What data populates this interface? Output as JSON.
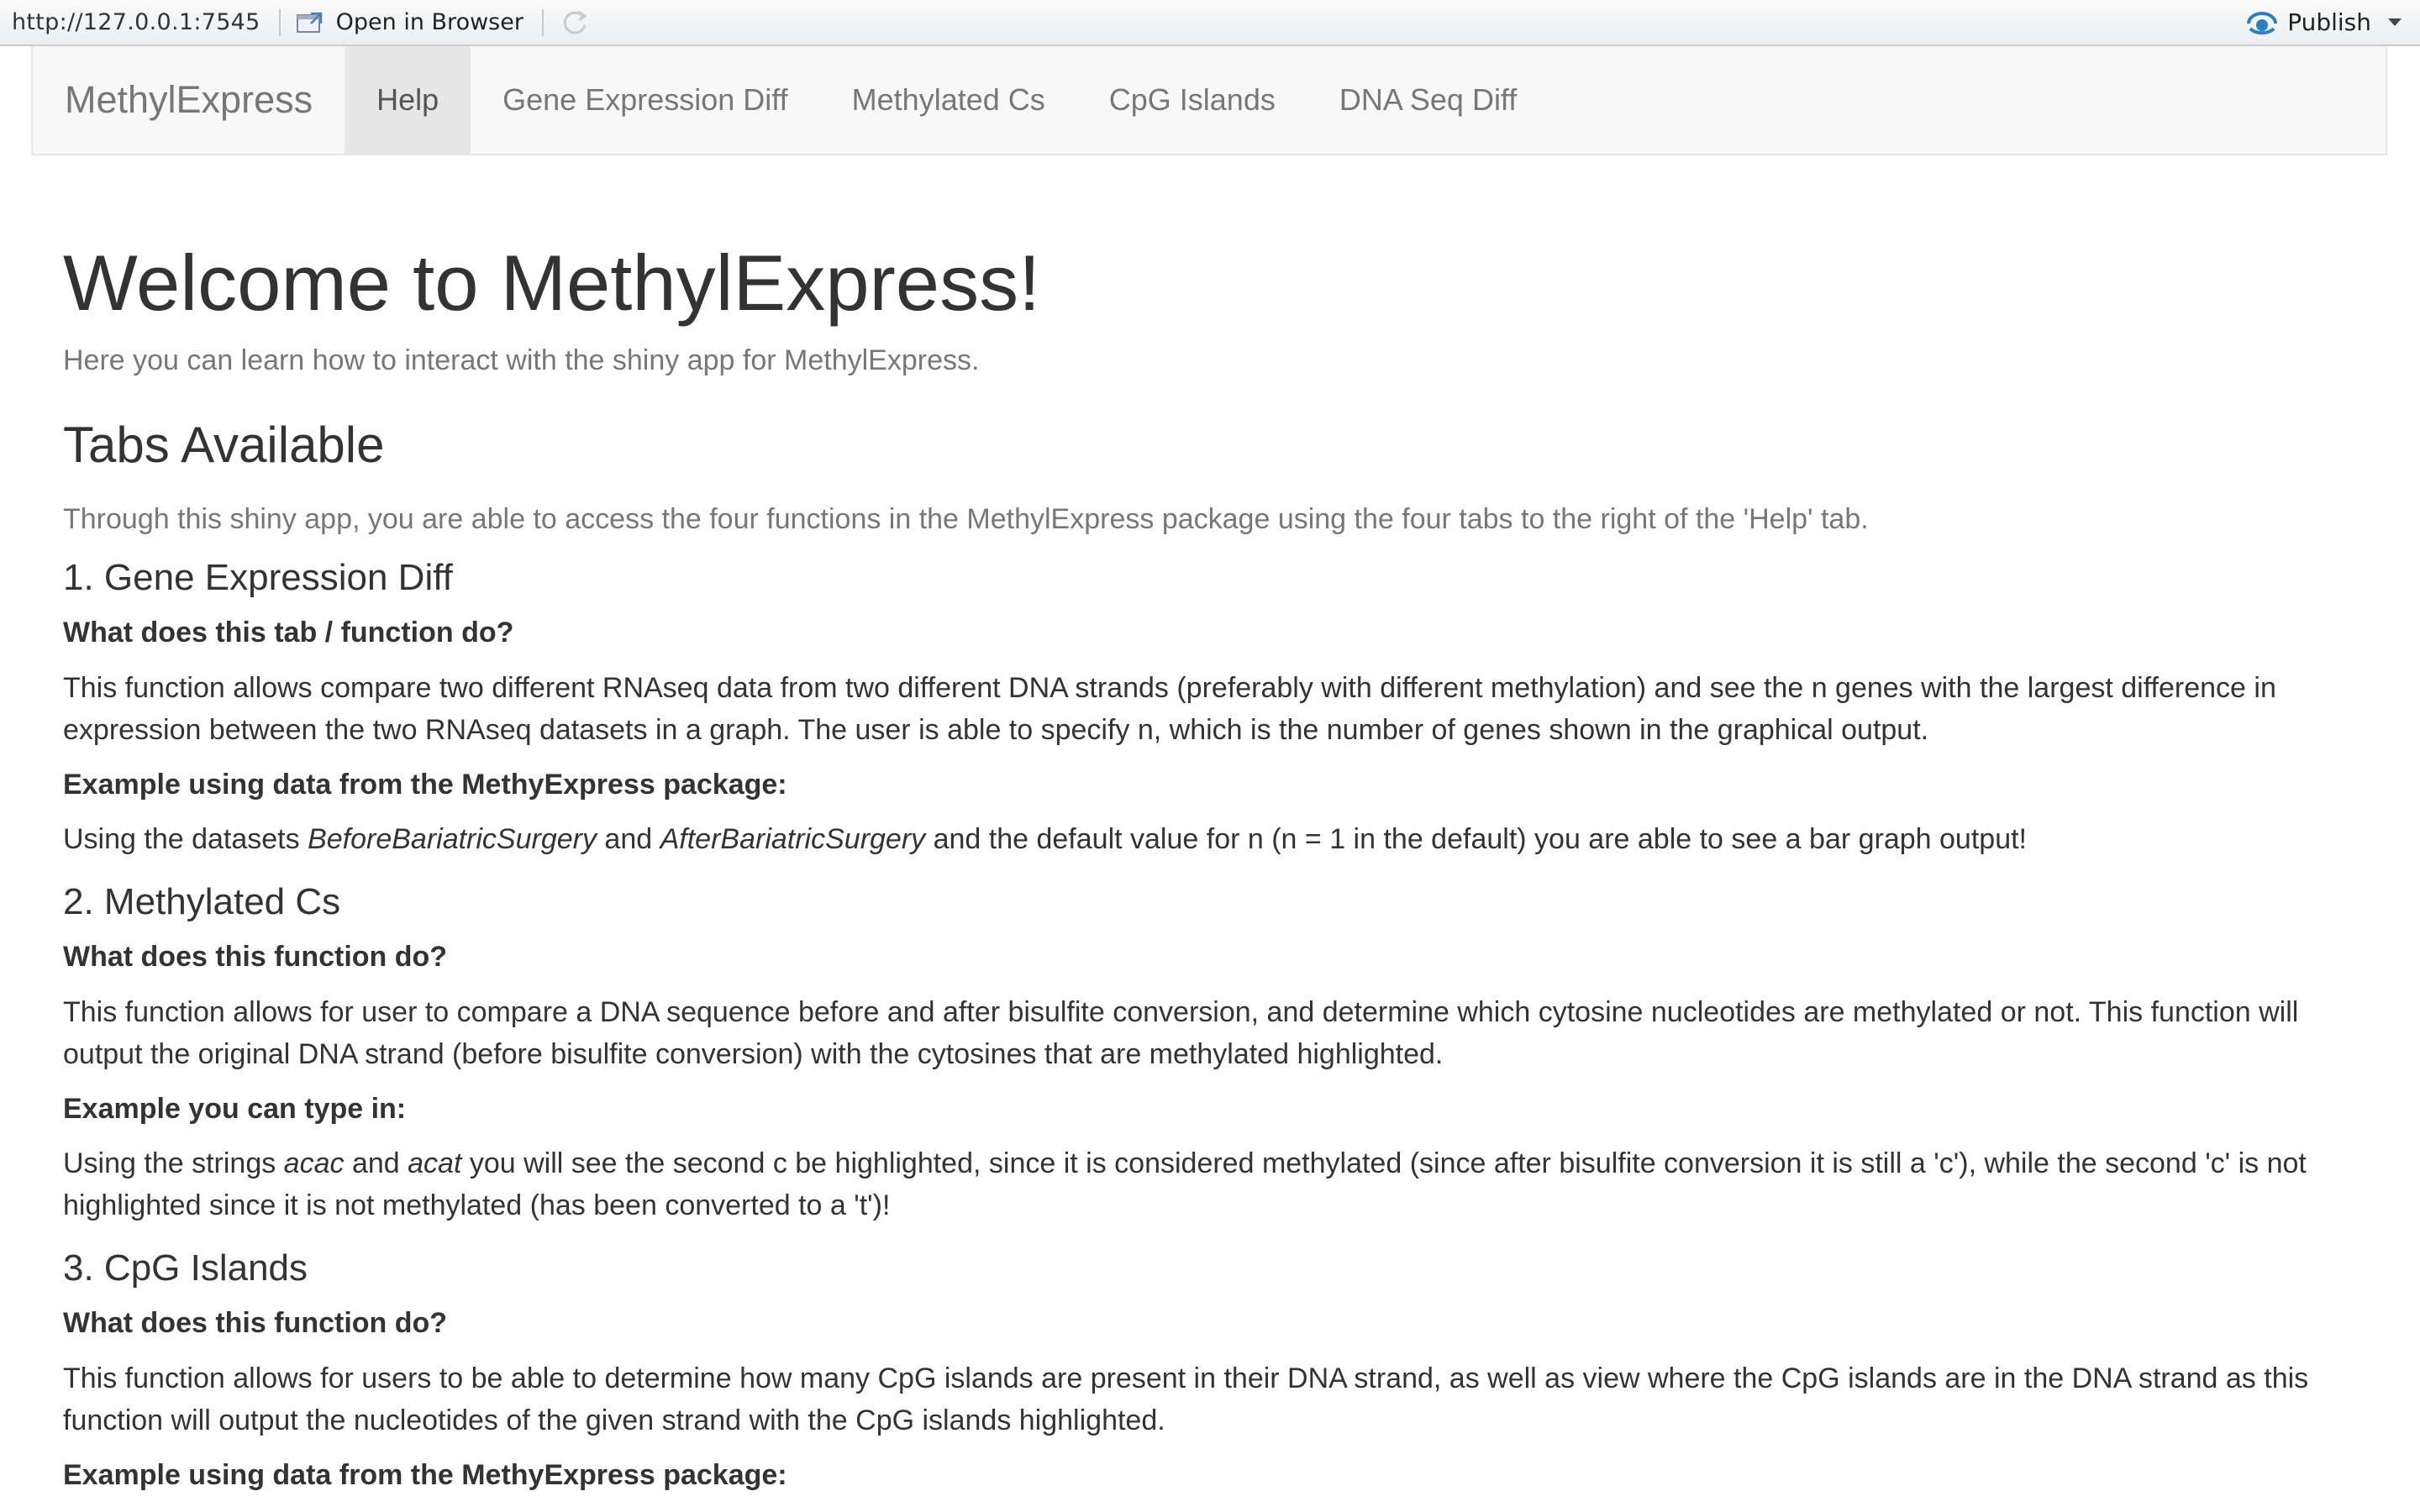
{
  "viewer": {
    "url": "http://127.0.0.1:7545",
    "open_in_browser": "Open in Browser",
    "publish": "Publish"
  },
  "navbar": {
    "brand": "MethylExpress",
    "tabs": [
      {
        "label": "Help",
        "active": true
      },
      {
        "label": "Gene Expression Diff",
        "active": false
      },
      {
        "label": "Methylated Cs",
        "active": false
      },
      {
        "label": "CpG Islands",
        "active": false
      },
      {
        "label": "DNA Seq Diff",
        "active": false
      }
    ]
  },
  "main": {
    "title": "Welcome to MethylExpress!",
    "subtitle": "Here you can learn how to interact with the shiny app for MethylExpress.",
    "tabs_heading": "Tabs Available",
    "tabs_intro": "Through this shiny app, you are able to access the four functions in the MethylExpress package using the four tabs to the right of the 'Help' tab.",
    "sections": [
      {
        "heading": "1. Gene Expression Diff",
        "question": "What does this tab / function do?",
        "description": "This function allows compare two different RNAseq data from two different DNA strands (preferably with different methylation) and see the n genes with the largest difference in expression between the two RNAseq datasets in a graph. The user is able to specify n, which is the number of genes shown in the graphical output.",
        "example_heading": "Example using data from the MethyExpress package:",
        "example_parts": [
          "Using the datasets ",
          "BeforeBariatricSurgery",
          " and ",
          "AfterBariatricSurgery",
          " and the default value for n (n = 1 in the default) you are able to see a bar graph output!"
        ]
      },
      {
        "heading": "2. Methylated Cs",
        "question": "What does this function do?",
        "description": "This function allows for user to compare a DNA sequence before and after bisulfite conversion, and determine which cytosine nucleotides are methylated or not. This function will output the original DNA strand (before bisulfite conversion) with the cytosines that are methylated highlighted.",
        "example_heading": "Example you can type in:",
        "example_parts": [
          "Using the strings ",
          "acac",
          " and ",
          "acat",
          " you will see the second c be highlighted, since it is considered methylated (since after bisulfite conversion it is still a 'c'), while the second 'c' is not highlighted since it is not methylated (has been converted to a 't')!"
        ]
      },
      {
        "heading": "3. CpG Islands",
        "question": "What does this function do?",
        "description": "This function allows for users to be able to determine how many CpG islands are present in their DNA strand, as well as view where the CpG islands are in the DNA strand as this function will output the nucleotides of the given strand with the CpG islands highlighted.",
        "example_heading": "Example using data from the MethyExpress package:"
      }
    ]
  }
}
